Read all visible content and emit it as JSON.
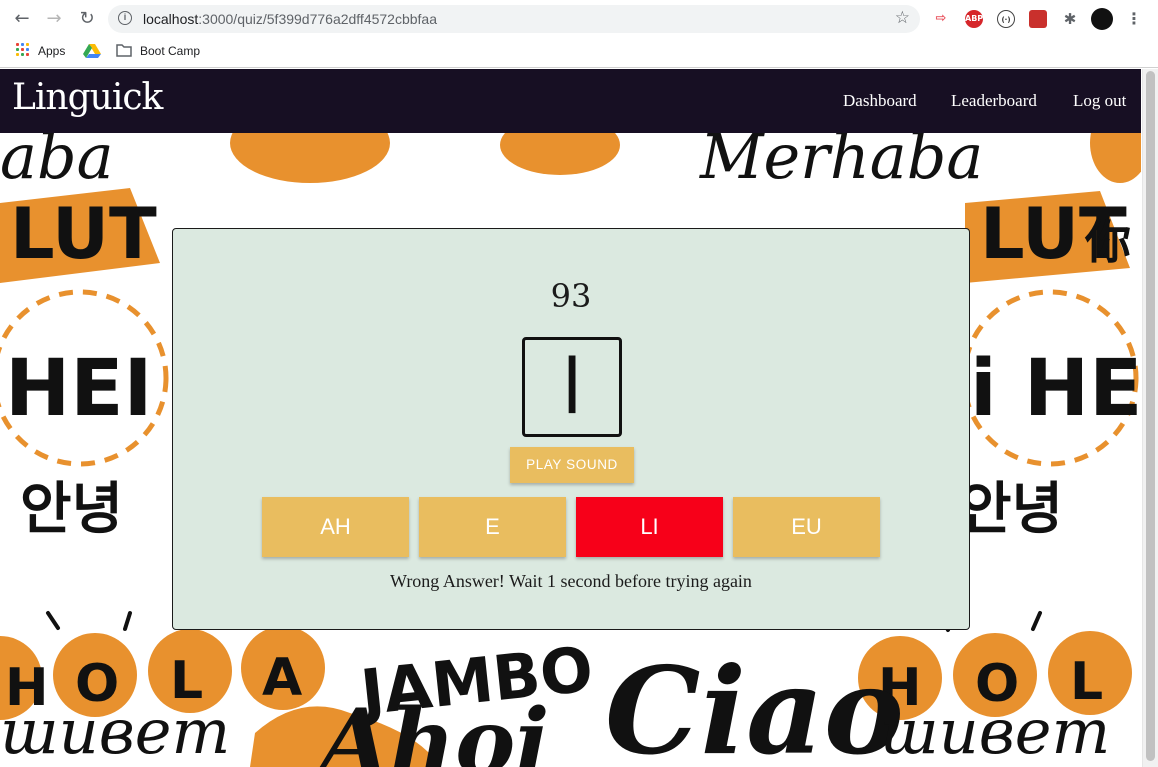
{
  "browser": {
    "url_host": "localhost",
    "url_path": ":3000/quiz/5f399d776a2dff4572cbbfaa",
    "bookmarks": [
      "Apps",
      "Boot Camp"
    ],
    "extensions": [
      "ABP"
    ]
  },
  "nav": {
    "brand": "Linguick",
    "links": [
      "Dashboard",
      "Leaderboard",
      "Log out"
    ]
  },
  "quiz": {
    "score": "93",
    "character": "l",
    "play_label": "PLAY SOUND",
    "answers": [
      {
        "label": "AH",
        "state": "default"
      },
      {
        "label": "E",
        "state": "default"
      },
      {
        "label": "LI",
        "state": "wrong"
      },
      {
        "label": "EU",
        "state": "default"
      }
    ],
    "feedback": "Wrong Answer! Wait 1 second before trying again"
  },
  "colors": {
    "nav_bg": "#170f23",
    "card_bg": "#dbe9e0",
    "answer_bg": "#e9bd5f",
    "wrong_bg": "#f70019",
    "accent_orange": "#e8912e"
  }
}
